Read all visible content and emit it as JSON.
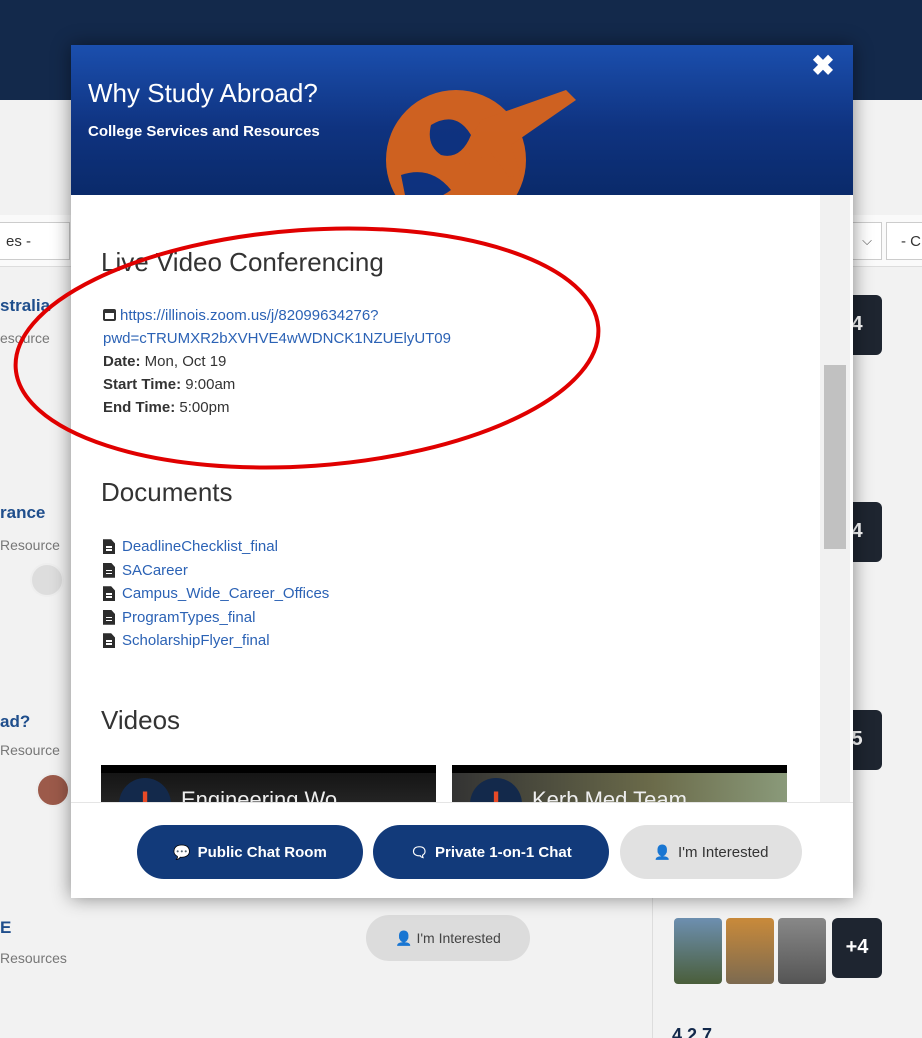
{
  "background": {
    "filter_left": "es -",
    "filter_right": "- C",
    "cards": [
      {
        "title": "stralia",
        "sub": "esource"
      },
      {
        "title": "rance",
        "sub": "Resource"
      },
      {
        "title": "ad?",
        "sub": "Resource"
      },
      {
        "title": "E",
        "sub": "Resources"
      }
    ],
    "thumb_counts": [
      "4",
      "4",
      "5",
      "+4"
    ],
    "interested_label": "I'm Interested",
    "counts_text": "4 2 7"
  },
  "modal": {
    "title": "Why Study Abroad?",
    "subtitle": "College Services and Resources",
    "close_icon": "close-icon",
    "live": {
      "heading": "Live Video Conferencing",
      "link_line1": "https://illinois.zoom.us/j/82099634276?",
      "link_line2": "pwd=cTRUMXR2bXVHVE4wWDNCK1NZUElyUT09",
      "date_label": "Date:",
      "date_value": " Mon, Oct 19",
      "start_label": "Start Time:",
      "start_value": " 9:00am",
      "end_label": "End Time:",
      "end_value": " 5:00pm"
    },
    "documents": {
      "heading": "Documents",
      "items": [
        "DeadlineChecklist_final",
        "SACareer",
        "Campus_Wide_Career_Offices",
        "ProgramTypes_final",
        "ScholarshipFlyer_final"
      ]
    },
    "videos": {
      "heading": "Videos",
      "items": [
        {
          "title": "Engineering Wo..."
        },
        {
          "title": "Kerb Med Team ..."
        }
      ]
    },
    "footer": {
      "public_chat": "Public Chat Room",
      "private_chat": "Private 1-on-1 Chat",
      "interested": "I'm Interested"
    }
  },
  "colors": {
    "header_blue": "#0f3380",
    "button_blue": "#123a7a",
    "link_blue": "#2b62b5",
    "annotation_red": "#e00000",
    "illini_orange": "#e84a27"
  }
}
